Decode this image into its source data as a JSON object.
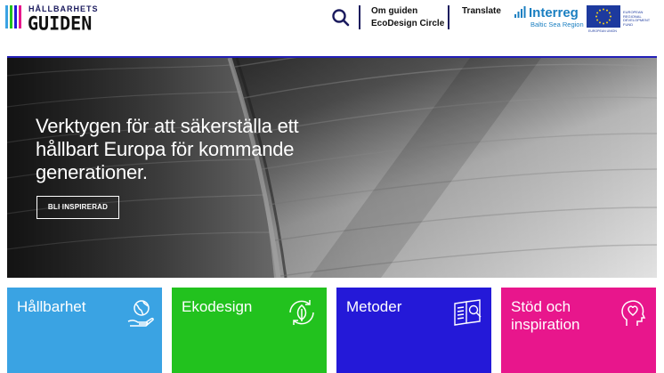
{
  "header": {
    "logo_small": "HÅLLBARHETS",
    "logo_big": "GUIDEN",
    "nav": {
      "about": "Om guiden",
      "ecodesign_circle": "EcoDesign Circle",
      "translate": "Translate"
    },
    "partner": {
      "name": "Interreg",
      "region": "Baltic Sea Region",
      "eu_caption": "EUROPEAN UNION",
      "fund": "EUROPEAN REGIONAL DEVELOPMENT FUND"
    },
    "icons": {
      "search": "search-icon"
    }
  },
  "hero": {
    "title": "Verktygen för att säkerställa ett hållbart Europa för kommande generationer.",
    "button": "BLI INSPIRERAD"
  },
  "tiles": [
    {
      "label": "Hållbarhet",
      "color": "#3aa3e3",
      "icon": "globe-hand-icon"
    },
    {
      "label": "Ekodesign",
      "color": "#22c21e",
      "icon": "leaf-cycle-icon"
    },
    {
      "label": "Metoder",
      "color": "#2419d8",
      "icon": "open-book-icon"
    },
    {
      "label": "Stöd och inspiration",
      "color": "#e8168c",
      "icon": "head-heart-icon"
    }
  ],
  "colors": {
    "accent": "#2420b8",
    "navy": "#1b1b5e"
  }
}
